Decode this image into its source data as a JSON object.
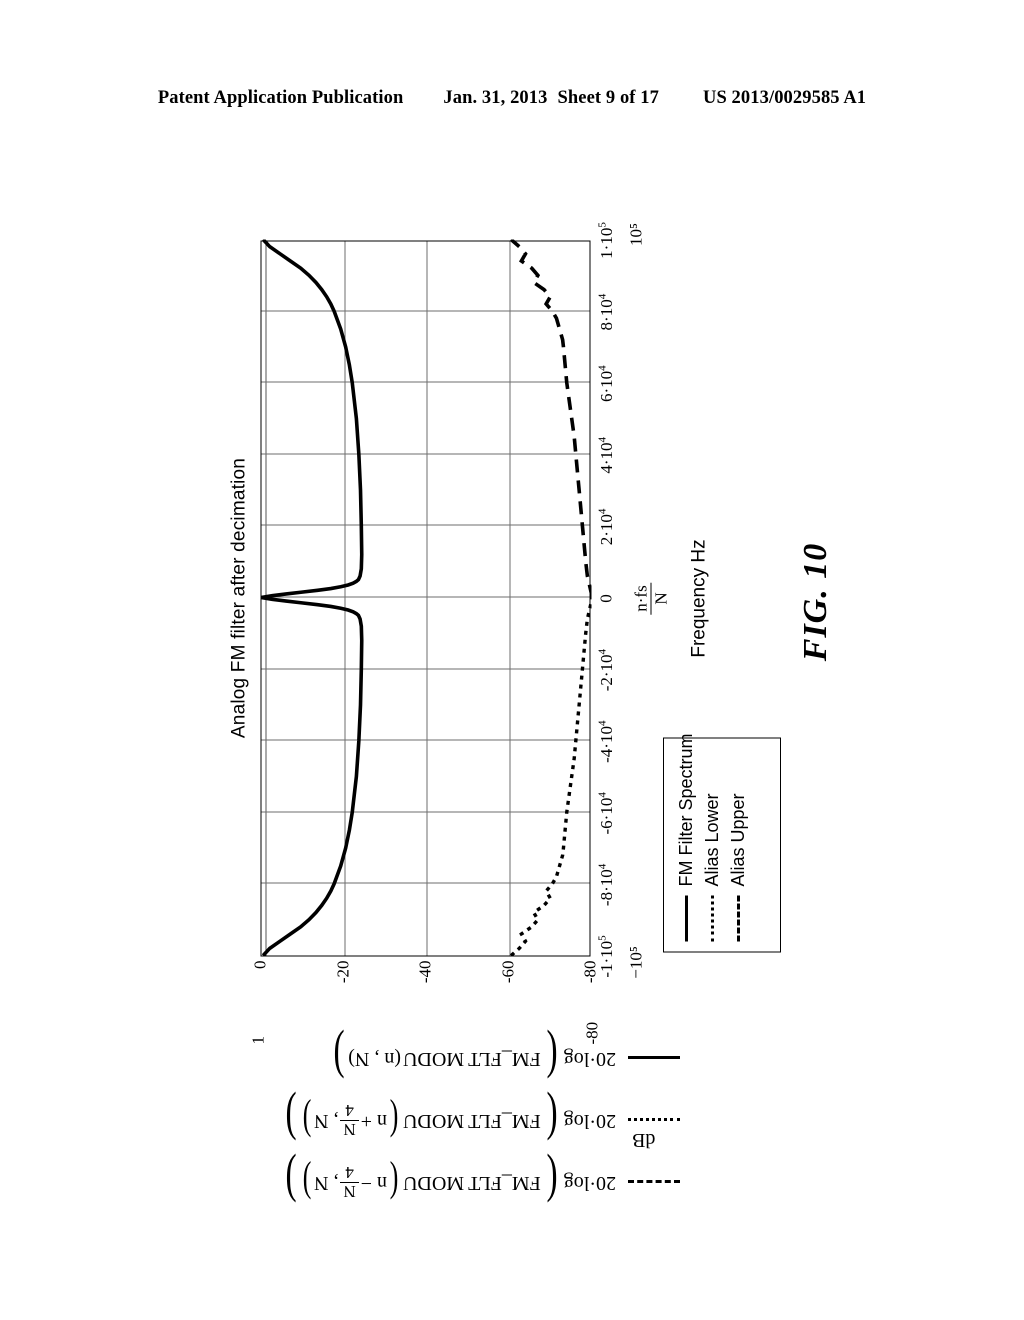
{
  "page_header": {
    "publication": "Patent Application Publication",
    "date": "Jan. 31, 2013",
    "sheet": "Sheet 9 of 17",
    "patent_number": "US 2013/0029585 A1"
  },
  "figure": {
    "label": "FIG. 10"
  },
  "chart_data": {
    "type": "line",
    "title": "Analog FM filter after decimation",
    "xlabel": "Frequency Hz",
    "xlabel_variable_numerator": "n·fs",
    "xlabel_variable_denominator": "N",
    "ylabel": "dB",
    "xlim": [
      -100000,
      100000
    ],
    "ylim": [
      -80,
      0
    ],
    "x_limit_low_label": "−10⁵",
    "x_limit_high_label": "10⁵",
    "y_limit_high_label": "1",
    "y_limit_low_label": "-80",
    "grid": true,
    "grid_x_divisions": 10,
    "grid_y_divisions": 4,
    "xticks": [
      {
        "value": -100000,
        "label": "-1·10",
        "exp": "5"
      },
      {
        "value": -80000,
        "label": "-8·10",
        "exp": "4"
      },
      {
        "value": -60000,
        "label": "-6·10",
        "exp": "4"
      },
      {
        "value": -40000,
        "label": "-4·10",
        "exp": "4"
      },
      {
        "value": -20000,
        "label": "-2·10",
        "exp": "4"
      },
      {
        "value": 0,
        "label": "0",
        "exp": ""
      },
      {
        "value": 20000,
        "label": "2·10",
        "exp": "4"
      },
      {
        "value": 40000,
        "label": "4·10",
        "exp": "4"
      },
      {
        "value": 60000,
        "label": "6·10",
        "exp": "4"
      },
      {
        "value": 80000,
        "label": "8·10",
        "exp": "4"
      },
      {
        "value": 100000,
        "label": "1·10",
        "exp": "5"
      }
    ],
    "yticks": [
      {
        "value": 0,
        "label": "0"
      },
      {
        "value": -20,
        "label": "-20"
      },
      {
        "value": -40,
        "label": "-40"
      },
      {
        "value": -60,
        "label": "-60"
      },
      {
        "value": -80,
        "label": "-80"
      }
    ],
    "legend_position": "below-right",
    "series": [
      {
        "name": "FM Filter Spectrum",
        "style": "solid",
        "expression": "20·log( FM_FLT MODU (n, N) )",
        "x": [
          -100000,
          -98000,
          -96000,
          -94000,
          -92000,
          -90000,
          -88000,
          -86000,
          -84000,
          -82000,
          -80000,
          -75000,
          -70000,
          -65000,
          -60000,
          -50000,
          -40000,
          -30000,
          -20000,
          -12000,
          -8000,
          -6000,
          -5000,
          -4500,
          -4000,
          -3500,
          -3000,
          -2500,
          -2000,
          -1500,
          -1000,
          -500,
          0,
          500,
          1000,
          1500,
          2000,
          2500,
          3000,
          3500,
          4000,
          4500,
          5000,
          6000,
          8000,
          12000,
          20000,
          30000,
          40000,
          50000,
          60000,
          65000,
          70000,
          75000,
          80000,
          82000,
          84000,
          86000,
          88000,
          90000,
          92000,
          94000,
          96000,
          98000,
          100000
        ],
        "y": [
          -0.4,
          -2.0,
          -4.5,
          -7.0,
          -9.5,
          -11.5,
          -13.2,
          -14.6,
          -15.8,
          -16.8,
          -17.6,
          -19.2,
          -20.4,
          -21.3,
          -22.0,
          -23.0,
          -23.6,
          -24.0,
          -24.2,
          -24.3,
          -24.2,
          -23.9,
          -23.5,
          -23.0,
          -22.2,
          -21.0,
          -19.2,
          -16.8,
          -13.6,
          -9.8,
          -6.0,
          -2.6,
          0.0,
          -2.6,
          -6.0,
          -9.8,
          -13.6,
          -16.8,
          -19.2,
          -21.0,
          -22.2,
          -23.0,
          -23.5,
          -23.9,
          -24.2,
          -24.3,
          -24.2,
          -24.0,
          -23.6,
          -23.0,
          -22.0,
          -21.3,
          -20.4,
          -19.2,
          -17.6,
          -16.8,
          -15.8,
          -14.6,
          -13.2,
          -11.5,
          -9.5,
          -7.0,
          -4.5,
          -2.0,
          -0.4
        ]
      },
      {
        "name": "Alias Lower",
        "style": "dotted",
        "expression": "20·log( FM_FLT MODU (n + N/4, N) )",
        "x": [
          -100000,
          -98000,
          -96000,
          -94000,
          -92000,
          -90000,
          -88000,
          -86000,
          -84000,
          -82000,
          -80000,
          -78000,
          -76000,
          -74000,
          -72000,
          -70000,
          -65000,
          -60000,
          -55000,
          -50000,
          -45000,
          -40000,
          -35000,
          -30000,
          -25000,
          -20000,
          -15000,
          -10000,
          -6000,
          -4000,
          -2000,
          -1000,
          0
        ],
        "y": [
          -60.5,
          -62.5,
          -64.0,
          -63.0,
          -65.5,
          -67.0,
          -66.0,
          -68.5,
          -70.0,
          -69.0,
          -70.5,
          -71.5,
          -72.0,
          -72.5,
          -73.0,
          -73.2,
          -73.6,
          -74.0,
          -74.6,
          -75.2,
          -75.8,
          -76.2,
          -76.6,
          -77.0,
          -77.4,
          -77.8,
          -78.2,
          -78.6,
          -79.0,
          -79.4,
          -79.8,
          -80.0,
          -80.0
        ]
      },
      {
        "name": "Alias Upper",
        "style": "dashed",
        "expression": "20·log( FM_FLT MODU (n − N/4, N) )",
        "x": [
          0,
          1000,
          2000,
          4000,
          6000,
          10000,
          15000,
          20000,
          25000,
          30000,
          35000,
          40000,
          45000,
          50000,
          55000,
          60000,
          65000,
          70000,
          72000,
          74000,
          76000,
          78000,
          80000,
          82000,
          84000,
          86000,
          88000,
          90000,
          92000,
          94000,
          96000,
          98000,
          100000
        ],
        "y": [
          -80.0,
          -80.0,
          -79.8,
          -79.4,
          -79.0,
          -78.6,
          -78.2,
          -77.8,
          -77.4,
          -77.0,
          -76.6,
          -76.2,
          -75.8,
          -75.2,
          -74.6,
          -74.0,
          -73.6,
          -73.2,
          -73.0,
          -72.5,
          -72.0,
          -71.5,
          -70.5,
          -69.0,
          -70.0,
          -68.5,
          -66.0,
          -67.0,
          -65.5,
          -63.0,
          -64.0,
          -62.5,
          -60.5
        ]
      }
    ],
    "legend_entries": [
      {
        "label": "FM Filter Spectrum",
        "style": "solid"
      },
      {
        "label": "Alias Lower",
        "style": "dotted"
      },
      {
        "label": "Alias Upper",
        "style": "dashed"
      }
    ],
    "math_expressions": [
      {
        "style": "dashed",
        "lead": "20·log",
        "fn": "FM_FLT",
        "modu": "MODU",
        "arg_prefix": "n −",
        "frac_num": "N",
        "frac_den": "4",
        "arg_suffix": ", N"
      },
      {
        "style": "dotted",
        "lead": "20·log",
        "fn": "FM_FLT",
        "modu": "MODU",
        "arg_prefix": "n +",
        "frac_num": "N",
        "frac_den": "4",
        "arg_suffix": ", N"
      },
      {
        "style": "solid",
        "lead": "20·log",
        "fn": "FM_FLT",
        "modu": "MODU",
        "arg_prefix": "(n , N)",
        "frac_num": "",
        "frac_den": "",
        "arg_suffix": ""
      }
    ],
    "units_label": "dB"
  }
}
